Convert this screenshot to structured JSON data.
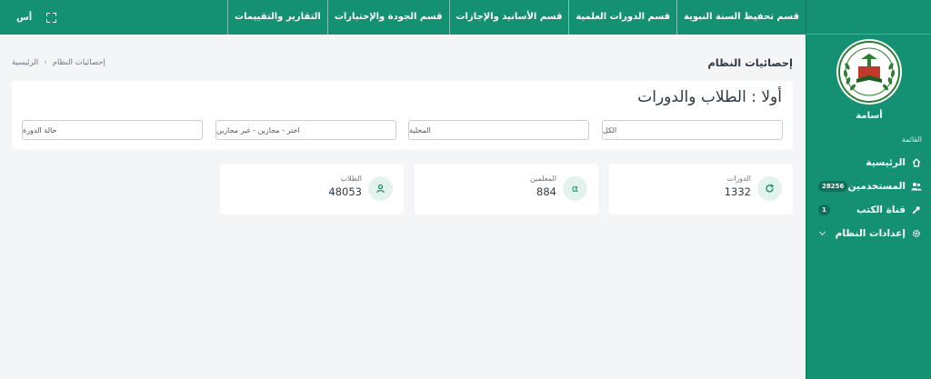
{
  "topbar": {
    "nav": [
      "قسم تحفيظ السنة النبوية",
      "قسم الدورات العلمية",
      "قسم الأسانيد والإجازات",
      "قسم الجودة والإختبارات",
      "التقارير والتقييمات"
    ],
    "user_short": "أس"
  },
  "sidebar": {
    "user_name": "أسامة",
    "menu_heading": "القائمة",
    "items": [
      {
        "label": "الرئيسية",
        "icon": "home-icon"
      },
      {
        "label": "المستخدمين",
        "icon": "users-icon",
        "badge": "28256"
      },
      {
        "label": "قناة الكتب",
        "icon": "books-icon",
        "badge": "1"
      },
      {
        "label": "إعدادات النظام",
        "icon": "settings-icon"
      }
    ]
  },
  "page": {
    "title": "إحصائيات النظام",
    "breadcrumb": {
      "home": "الرئيسية",
      "current": "إحصائيات النظام"
    }
  },
  "filters": {
    "title": "أولا : الطلاب والدورات",
    "fields": [
      "الكل",
      "المحلية",
      "اختر - مجازين - غير مجازين",
      "حالة الدورة"
    ]
  },
  "stats": [
    {
      "label": "الدورات",
      "value": "1332",
      "icon": "refresh-icon"
    },
    {
      "label": "المعلمين",
      "value": "884",
      "icon": "alpha-icon"
    },
    {
      "label": "الطلاب",
      "value": "48053",
      "icon": "user-icon"
    }
  ],
  "colors": {
    "primary": "#149172",
    "background": "#f4f5f7",
    "card": "#ffffff"
  }
}
